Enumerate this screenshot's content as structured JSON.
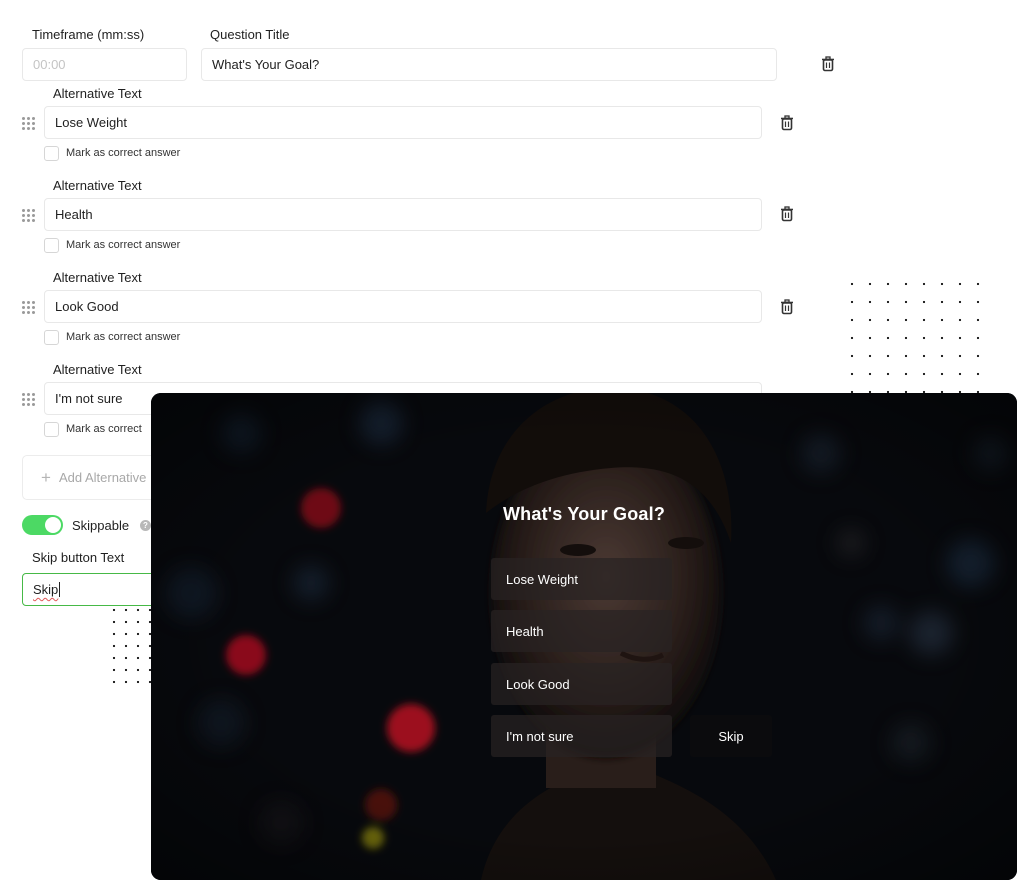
{
  "form": {
    "timeframe_label": "Timeframe (mm:ss)",
    "timeframe_placeholder": "00:00",
    "title_label": "Question Title",
    "title_value": "What's Your Goal?",
    "alternative_label": "Alternative Text",
    "mark_correct_label": "Mark as correct answer",
    "mark_correct_truncated": "Mark as correct",
    "alternatives": [
      {
        "value": "Lose Weight"
      },
      {
        "value": "Health"
      },
      {
        "value": "Look Good"
      },
      {
        "value": "I'm not sure"
      }
    ],
    "add_alternative_label": "Add Alternative",
    "skippable_label": "Skippable",
    "skip_button_label": "Skip button Text",
    "skip_button_value": "Skip"
  },
  "preview": {
    "question": "What's Your Goal?",
    "options": [
      "Lose Weight",
      "Health",
      "Look Good",
      "I'm not sure"
    ],
    "skip_label": "Skip"
  },
  "icons": {
    "delete": "trash-icon",
    "drag": "drag-handle-icon",
    "add": "plus-icon",
    "help": "help-icon"
  },
  "colors": {
    "toggle_on": "#4cd964",
    "focus_border": "#46b946",
    "preview_bg": "#0a0c10",
    "bokeh_red": "#e0102a"
  }
}
